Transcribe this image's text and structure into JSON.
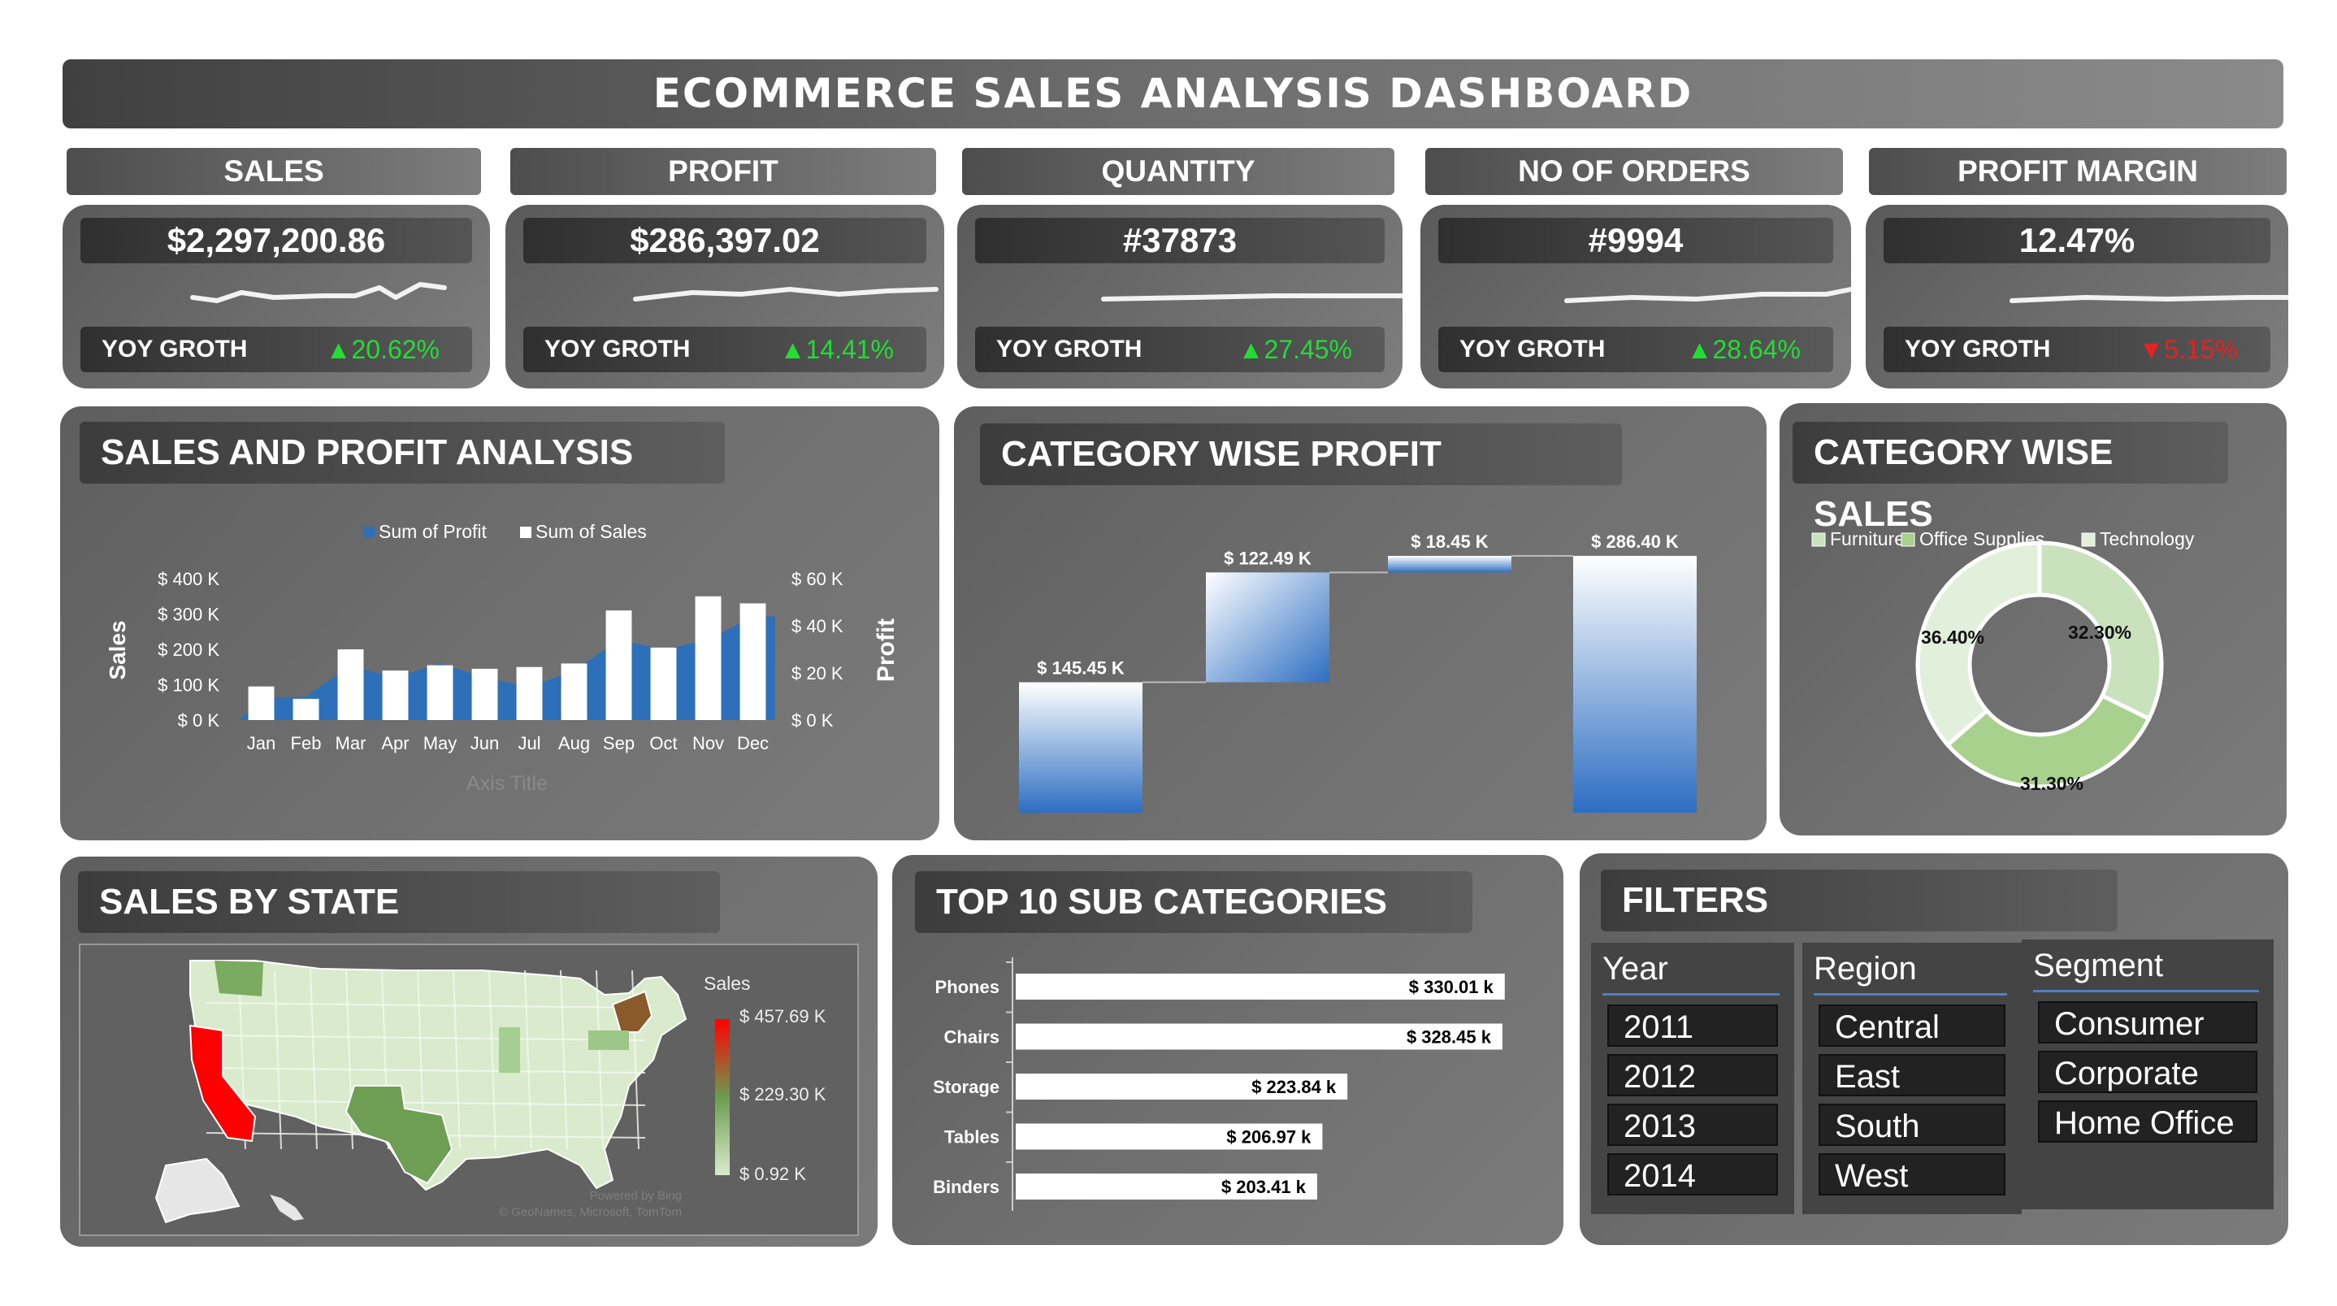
{
  "title": "ECOMMERCE SALES ANALYSIS DASHBOARD",
  "kpis": [
    {
      "head": "SALES",
      "value": "$2,297,200.86",
      "yoy_label": "YOY GROTH",
      "yoy": "20.62%",
      "dir": "up",
      "arrow": "▲"
    },
    {
      "head": "PROFIT",
      "value": "$286,397.02",
      "yoy_label": "YOY GROTH",
      "yoy": "14.41%",
      "dir": "up",
      "arrow": "▲"
    },
    {
      "head": "QUANTITY",
      "value": "#37873",
      "yoy_label": "YOY GROTH",
      "yoy": "27.45%",
      "dir": "up",
      "arrow": "▲"
    },
    {
      "head": "NO OF ORDERS",
      "value": "#9994",
      "yoy_label": "YOY GROTH",
      "yoy": "28.64%",
      "dir": "up",
      "arrow": "▲"
    },
    {
      "head": "PROFIT MARGIN",
      "value": "12.47%",
      "yoy_label": "YOY GROTH",
      "yoy": "5.15%",
      "dir": "down",
      "arrow": "▼"
    }
  ],
  "sections": {
    "sales_profit": "SALES AND PROFIT ANALYSIS",
    "cat_profit": "CATEGORY WISE PROFIT",
    "cat_sales": "CATEGORY WISE SALES",
    "state": "SALES BY STATE",
    "top10": "TOP 10 SUB CATEGORIES",
    "filters": "FILTERS"
  },
  "chart_data": [
    {
      "type": "bar",
      "categories": [
        "Jan",
        "Feb",
        "Mar",
        "Apr",
        "May",
        "Jun",
        "Jul",
        "Aug",
        "Sep",
        "Oct",
        "Nov",
        "Dec"
      ],
      "series": [
        {
          "name": "Sum of Profit",
          "axis": "right",
          "values": [
            9000,
            10000,
            23000,
            18000,
            24000,
            18000,
            14000,
            21000,
            34000,
            30000,
            34000,
            44000
          ]
        },
        {
          "name": "Sum of Sales",
          "axis": "left",
          "values": [
            95000,
            60000,
            200000,
            140000,
            155000,
            145000,
            150000,
            160000,
            310000,
            205000,
            350000,
            330000
          ]
        }
      ],
      "left_axis": {
        "label": "Sales",
        "ticks": [
          "$ 0 K",
          "$ 100 K",
          "$ 200 K",
          "$ 300 K",
          "$ 400 K"
        ],
        "ylim": [
          0,
          400000
        ]
      },
      "right_axis": {
        "label": "Profit",
        "ticks": [
          "$ 0 K",
          "$ 20 K",
          "$ 40 K",
          "$ 60 K"
        ],
        "ylim": [
          0,
          60000
        ]
      },
      "xlabel": "Axis Title",
      "colors": {
        "profit": "#2e6fba",
        "sales": "#ffffff"
      }
    },
    {
      "type": "bar",
      "subtype": "waterfall",
      "labels": [
        "$ 145.45 K",
        "$ 122.49 K",
        "$ 18.45 K",
        "$ 286.40 K"
      ],
      "values": [
        145.45,
        122.49,
        18.45,
        286.4
      ],
      "total_index": 3,
      "ylim": [
        0,
        290
      ]
    },
    {
      "type": "pie",
      "subtype": "donut",
      "legend": [
        "Furniture",
        "Office Supplies",
        "Technology"
      ],
      "values": [
        32.3,
        31.3,
        36.4
      ],
      "labels": [
        "32.30%",
        "31.30%",
        "36.40%"
      ],
      "colors": [
        "#c9e2bd",
        "#a9d18e",
        "#e2efda"
      ]
    },
    {
      "type": "bar",
      "orientation": "horizontal",
      "categories": [
        "Phones",
        "Chairs",
        "Storage",
        "Tables",
        "Binders"
      ],
      "values": [
        330.01,
        328.45,
        223.84,
        206.97,
        203.41
      ],
      "labels": [
        "$ 330.01 k",
        "$ 328.45 k",
        "$ 223.84 k",
        "$ 206.97 k",
        "$ 203.41 k"
      ],
      "xlim": [
        0,
        340
      ]
    }
  ],
  "map": {
    "legend_title": "Sales",
    "legend_ticks": [
      "$ 457.69 K",
      "$ 229.30 K",
      "$ 0.92 K"
    ],
    "credit1": "Powered by Bing",
    "credit2": "© GeoNames, Microsoft, TomTom",
    "colors": {
      "high": "#ff0000",
      "mid": "#6a9c50",
      "low": "#d9ebcc"
    }
  },
  "filters": [
    {
      "head": "Year",
      "items": [
        "2011",
        "2012",
        "2013",
        "2014"
      ]
    },
    {
      "head": "Region",
      "items": [
        "Central",
        "East",
        "South",
        "West"
      ]
    },
    {
      "head": "Segment",
      "items": [
        "Consumer",
        "Corporate",
        "Home Office"
      ]
    }
  ]
}
